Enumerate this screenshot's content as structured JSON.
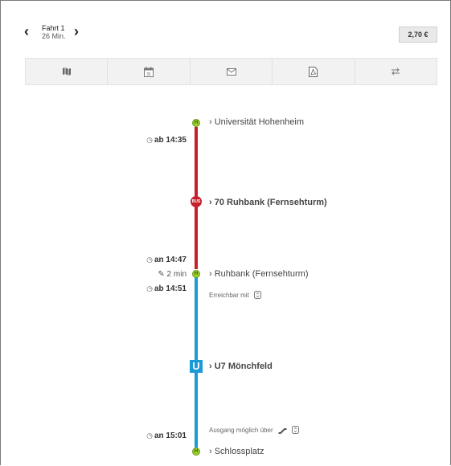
{
  "header": {
    "prev_label": "‹",
    "next_label": "›",
    "trip_title": "Fahrt 1",
    "trip_duration": "26 Min.",
    "price": "2,70 €"
  },
  "toolbar": {
    "items": [
      {
        "name": "map-icon"
      },
      {
        "name": "calendar-icon",
        "text": "31"
      },
      {
        "name": "mail-icon"
      },
      {
        "name": "pdf-icon"
      },
      {
        "name": "swap-direction-icon"
      }
    ]
  },
  "itinerary": {
    "stops": {
      "start": "› Universität Hohenheim",
      "transfer": "› Ruhbank (Fernsehturm)",
      "end": "› Schlossplatz"
    },
    "stop_badge": "H",
    "bus_badge": "BUS",
    "ubahn_badge": "U",
    "bus_line": "› 70 Ruhbank (Fernsehturm)",
    "ubahn_line": "› U7 Mönchfeld",
    "times": {
      "dep1": "ab 14:35",
      "arr1": "an 14:47",
      "walk": "2 min",
      "dep2": "ab 14:51",
      "arr2": "an 15:01"
    },
    "notes": {
      "reachable": "Erreichbar mit",
      "exit": "Ausgang möglich über"
    },
    "colors": {
      "bus": "#c5202c",
      "ubahn": "#1a9ad6",
      "stop": "#9ccf2f"
    }
  }
}
